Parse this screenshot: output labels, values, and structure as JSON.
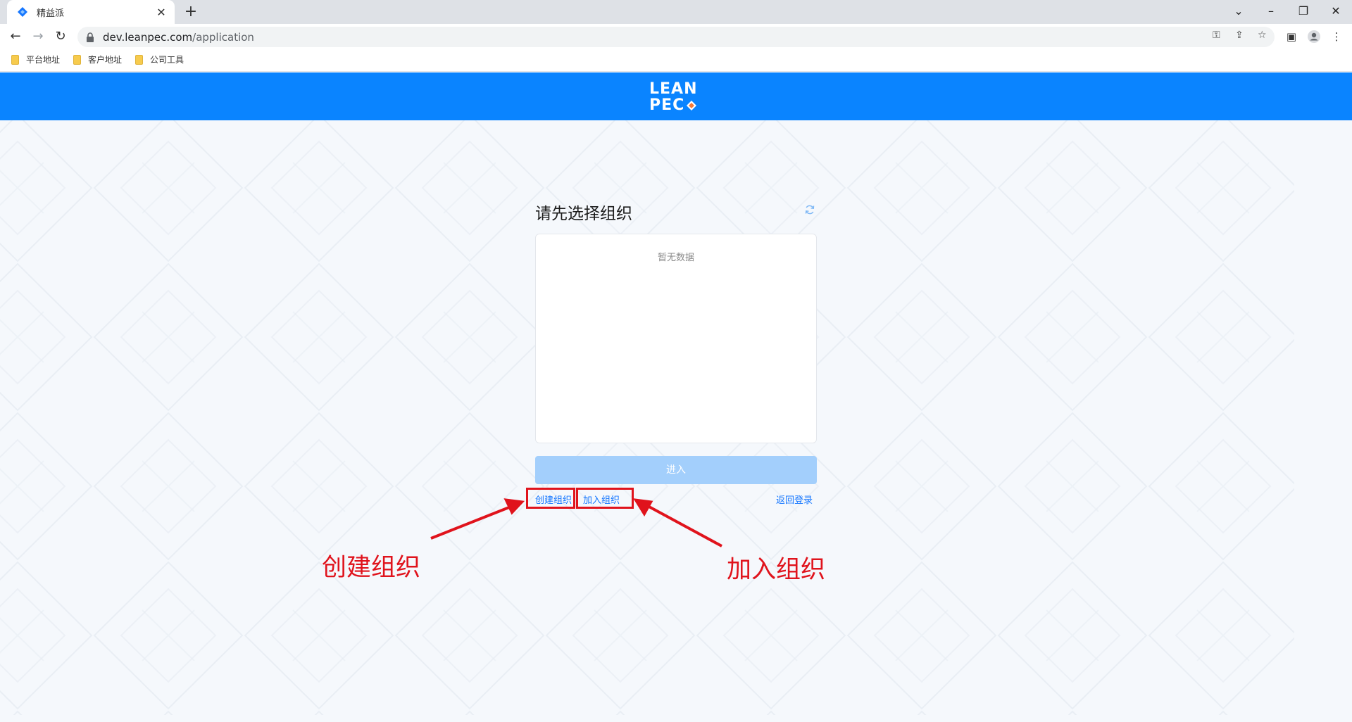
{
  "browser": {
    "tab_title": "精益派",
    "url_domain": "dev.leanpec.com",
    "url_path": "/application",
    "bookmarks": [
      "平台地址",
      "客户地址",
      "公司工具"
    ]
  },
  "header": {
    "logo_line1": "LEAN",
    "logo_line2": "PEC"
  },
  "main": {
    "title": "请先选择组织",
    "empty_text": "暂无数据",
    "enter_label": "进入",
    "create_org_label": "创建组织",
    "join_org_label": "加入组织",
    "back_login_label": "返回登录"
  },
  "annotations": {
    "create_label": "创建组织",
    "join_label": "加入组织",
    "color": "#e0131c"
  },
  "colors": {
    "header_blue": "#0a84ff",
    "link_blue": "#1677ff",
    "button_disabled": "#a3cffc"
  }
}
